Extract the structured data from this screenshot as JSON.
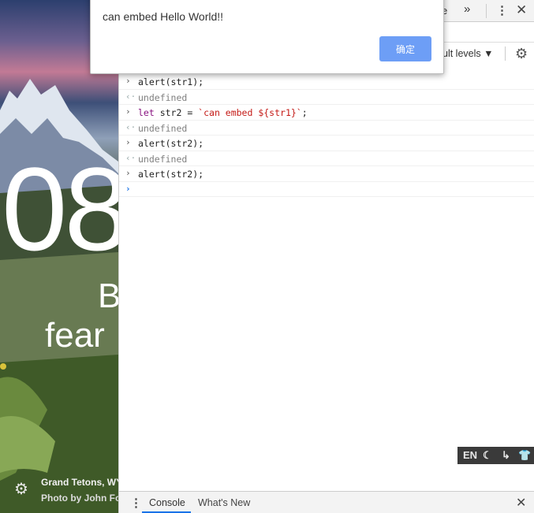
{
  "background": {
    "clock": "08",
    "greeting_line1": "B",
    "greeting_line2": "fear",
    "location": "Grand Tetons, WY",
    "photo_credit": "Photo by John Fo"
  },
  "devtools": {
    "top_tab_partial": "e",
    "more_tabs_icon": "»",
    "menu_icon": "⋮",
    "close_icon": "✕",
    "levels_label": "ult levels ▼",
    "settings_icon": "⚙",
    "console_lines": [
      {
        "kind": "input",
        "mark": "›",
        "text": "alert(str1);"
      },
      {
        "kind": "result",
        "mark": "‹·",
        "text": "undefined"
      },
      {
        "kind": "input",
        "mark": "›",
        "keyword": "let",
        "rest": " str2 = ",
        "string": "`can embed ${str1}`",
        "end": ";"
      },
      {
        "kind": "result",
        "mark": "‹·",
        "text": "undefined"
      },
      {
        "kind": "input",
        "mark": "›",
        "text": "alert(str2);"
      },
      {
        "kind": "result",
        "mark": "‹·",
        "text": "undefined"
      },
      {
        "kind": "input",
        "mark": "›",
        "text": "alert(str2);"
      },
      {
        "kind": "prompt",
        "mark": "›",
        "text": ""
      }
    ],
    "drawer": {
      "menu_icon": "⋮",
      "tabs": [
        "Console",
        "What's New"
      ],
      "close_icon": "✕"
    }
  },
  "extension_bar": {
    "lang": "EN",
    "moon_icon": "☾",
    "pin_icon": "↳",
    "shirt_icon": "👕"
  },
  "dialog": {
    "title_partial": "̶ ̶ ̶",
    "message": "can embed Hello World!!",
    "ok_label": "确定"
  },
  "colors": {
    "accent": "#1a73e8",
    "ok_button": "#6d9ef6",
    "string": "#c41a16",
    "keyword": "#881280"
  }
}
